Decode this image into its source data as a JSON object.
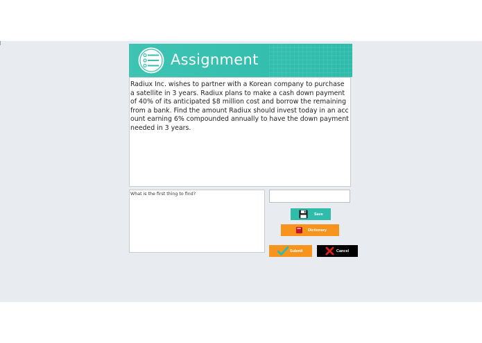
{
  "header": {
    "title": "Assignment",
    "icon": "checklist-icon",
    "color": "#35bfae"
  },
  "problem": {
    "text": "Radiux Inc. wishes to partner with a Korean company to purchase a satellite in 3 years. Radiux plans to make a cash down payment of 40% of its anticipated $8 million cost and borrow the remaining from a bank. Find the amount Radiux should invest today in an account earning 6% compounded annually to have the down payment needed in 3 years."
  },
  "answer": {
    "prompt": "What is the first thing to find?"
  },
  "buttons": {
    "save": "Save",
    "dictionary": "Dictionary",
    "submit": "Submit",
    "cancel": "Cancel"
  },
  "colors": {
    "accent": "#2fbcab",
    "orange": "#f7941d",
    "dark": "#000000",
    "background": "#e8ebef"
  }
}
